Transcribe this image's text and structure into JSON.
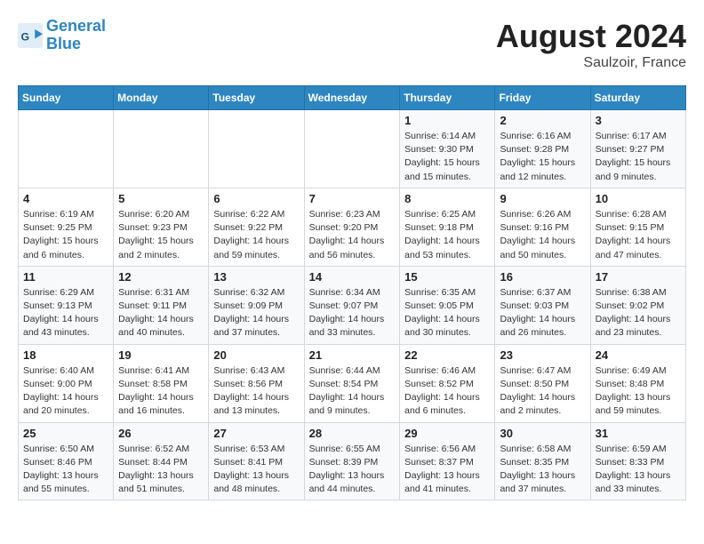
{
  "header": {
    "logo_line1": "General",
    "logo_line2": "Blue",
    "month_year": "August 2024",
    "location": "Saulzoir, France"
  },
  "weekdays": [
    "Sunday",
    "Monday",
    "Tuesday",
    "Wednesday",
    "Thursday",
    "Friday",
    "Saturday"
  ],
  "weeks": [
    [
      {
        "day": "",
        "info": ""
      },
      {
        "day": "",
        "info": ""
      },
      {
        "day": "",
        "info": ""
      },
      {
        "day": "",
        "info": ""
      },
      {
        "day": "1",
        "info": "Sunrise: 6:14 AM\nSunset: 9:30 PM\nDaylight: 15 hours\nand 15 minutes."
      },
      {
        "day": "2",
        "info": "Sunrise: 6:16 AM\nSunset: 9:28 PM\nDaylight: 15 hours\nand 12 minutes."
      },
      {
        "day": "3",
        "info": "Sunrise: 6:17 AM\nSunset: 9:27 PM\nDaylight: 15 hours\nand 9 minutes."
      }
    ],
    [
      {
        "day": "4",
        "info": "Sunrise: 6:19 AM\nSunset: 9:25 PM\nDaylight: 15 hours\nand 6 minutes."
      },
      {
        "day": "5",
        "info": "Sunrise: 6:20 AM\nSunset: 9:23 PM\nDaylight: 15 hours\nand 2 minutes."
      },
      {
        "day": "6",
        "info": "Sunrise: 6:22 AM\nSunset: 9:22 PM\nDaylight: 14 hours\nand 59 minutes."
      },
      {
        "day": "7",
        "info": "Sunrise: 6:23 AM\nSunset: 9:20 PM\nDaylight: 14 hours\nand 56 minutes."
      },
      {
        "day": "8",
        "info": "Sunrise: 6:25 AM\nSunset: 9:18 PM\nDaylight: 14 hours\nand 53 minutes."
      },
      {
        "day": "9",
        "info": "Sunrise: 6:26 AM\nSunset: 9:16 PM\nDaylight: 14 hours\nand 50 minutes."
      },
      {
        "day": "10",
        "info": "Sunrise: 6:28 AM\nSunset: 9:15 PM\nDaylight: 14 hours\nand 47 minutes."
      }
    ],
    [
      {
        "day": "11",
        "info": "Sunrise: 6:29 AM\nSunset: 9:13 PM\nDaylight: 14 hours\nand 43 minutes."
      },
      {
        "day": "12",
        "info": "Sunrise: 6:31 AM\nSunset: 9:11 PM\nDaylight: 14 hours\nand 40 minutes."
      },
      {
        "day": "13",
        "info": "Sunrise: 6:32 AM\nSunset: 9:09 PM\nDaylight: 14 hours\nand 37 minutes."
      },
      {
        "day": "14",
        "info": "Sunrise: 6:34 AM\nSunset: 9:07 PM\nDaylight: 14 hours\nand 33 minutes."
      },
      {
        "day": "15",
        "info": "Sunrise: 6:35 AM\nSunset: 9:05 PM\nDaylight: 14 hours\nand 30 minutes."
      },
      {
        "day": "16",
        "info": "Sunrise: 6:37 AM\nSunset: 9:03 PM\nDaylight: 14 hours\nand 26 minutes."
      },
      {
        "day": "17",
        "info": "Sunrise: 6:38 AM\nSunset: 9:02 PM\nDaylight: 14 hours\nand 23 minutes."
      }
    ],
    [
      {
        "day": "18",
        "info": "Sunrise: 6:40 AM\nSunset: 9:00 PM\nDaylight: 14 hours\nand 20 minutes."
      },
      {
        "day": "19",
        "info": "Sunrise: 6:41 AM\nSunset: 8:58 PM\nDaylight: 14 hours\nand 16 minutes."
      },
      {
        "day": "20",
        "info": "Sunrise: 6:43 AM\nSunset: 8:56 PM\nDaylight: 14 hours\nand 13 minutes."
      },
      {
        "day": "21",
        "info": "Sunrise: 6:44 AM\nSunset: 8:54 PM\nDaylight: 14 hours\nand 9 minutes."
      },
      {
        "day": "22",
        "info": "Sunrise: 6:46 AM\nSunset: 8:52 PM\nDaylight: 14 hours\nand 6 minutes."
      },
      {
        "day": "23",
        "info": "Sunrise: 6:47 AM\nSunset: 8:50 PM\nDaylight: 14 hours\nand 2 minutes."
      },
      {
        "day": "24",
        "info": "Sunrise: 6:49 AM\nSunset: 8:48 PM\nDaylight: 13 hours\nand 59 minutes."
      }
    ],
    [
      {
        "day": "25",
        "info": "Sunrise: 6:50 AM\nSunset: 8:46 PM\nDaylight: 13 hours\nand 55 minutes."
      },
      {
        "day": "26",
        "info": "Sunrise: 6:52 AM\nSunset: 8:44 PM\nDaylight: 13 hours\nand 51 minutes."
      },
      {
        "day": "27",
        "info": "Sunrise: 6:53 AM\nSunset: 8:41 PM\nDaylight: 13 hours\nand 48 minutes."
      },
      {
        "day": "28",
        "info": "Sunrise: 6:55 AM\nSunset: 8:39 PM\nDaylight: 13 hours\nand 44 minutes."
      },
      {
        "day": "29",
        "info": "Sunrise: 6:56 AM\nSunset: 8:37 PM\nDaylight: 13 hours\nand 41 minutes."
      },
      {
        "day": "30",
        "info": "Sunrise: 6:58 AM\nSunset: 8:35 PM\nDaylight: 13 hours\nand 37 minutes."
      },
      {
        "day": "31",
        "info": "Sunrise: 6:59 AM\nSunset: 8:33 PM\nDaylight: 13 hours\nand 33 minutes."
      }
    ]
  ]
}
